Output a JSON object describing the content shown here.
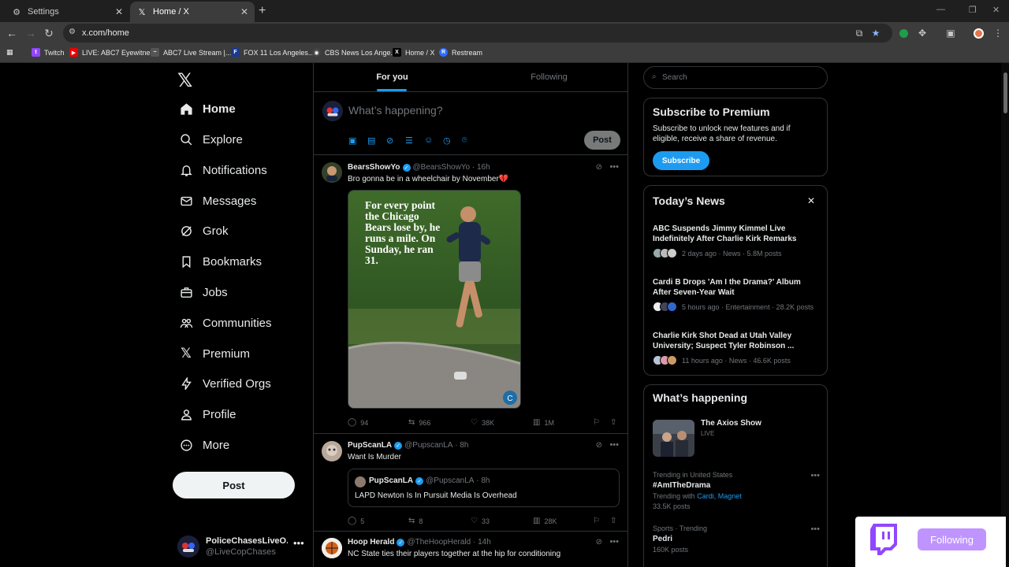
{
  "browser": {
    "tabs": [
      {
        "title": "Settings",
        "icon": "gear-icon"
      },
      {
        "title": "Home / X",
        "icon": "x-logo-icon"
      }
    ],
    "url": "x.com/home",
    "bookmarks": [
      {
        "label": "Twitch",
        "color": "#9146ff"
      },
      {
        "label": "LIVE: ABC7 Eyewitne...",
        "color": "#e00"
      },
      {
        "label": "ABC7 Live Stream |...",
        "color": "#555"
      },
      {
        "label": "FOX 11 Los Angeles...",
        "color": "#1b3a8c"
      },
      {
        "label": "CBS News Los Ange...",
        "color": "#444"
      },
      {
        "label": "Home / X",
        "color": "#000"
      },
      {
        "label": "Restream",
        "color": "#2f6bff"
      }
    ]
  },
  "sidebar": {
    "nav": [
      {
        "label": "Home",
        "icon": "home-icon"
      },
      {
        "label": "Explore",
        "icon": "search-icon"
      },
      {
        "label": "Notifications",
        "icon": "bell-icon"
      },
      {
        "label": "Messages",
        "icon": "mail-icon"
      },
      {
        "label": "Grok",
        "icon": "grok-icon"
      },
      {
        "label": "Bookmarks",
        "icon": "bookmark-icon"
      },
      {
        "label": "Jobs",
        "icon": "briefcase-icon"
      },
      {
        "label": "Communities",
        "icon": "people-icon"
      },
      {
        "label": "Premium",
        "icon": "x-logo-icon"
      },
      {
        "label": "Verified Orgs",
        "icon": "lightning-icon"
      },
      {
        "label": "Profile",
        "icon": "person-icon"
      },
      {
        "label": "More",
        "icon": "more-circle-icon"
      }
    ],
    "post_label": "Post",
    "account": {
      "name": "PoliceChasesLiveO...",
      "handle": "@LiveCopChases"
    }
  },
  "timeline": {
    "tabs": [
      "For you",
      "Following"
    ],
    "compose": {
      "placeholder": "What’s happening?",
      "post_label": "Post"
    },
    "tweets": [
      {
        "name": "BearsShowYo",
        "handle": "@BearsShowYo",
        "time": "16h",
        "text": "Bro gonna be in a wheelchair by November💔",
        "image_caption": "For every point the Chicago Bears lose by, he runs a mile. On Sunday, he ran 31.",
        "replies": "94",
        "reposts": "966",
        "likes": "38K",
        "views": "1M"
      },
      {
        "name": "PupScanLA",
        "handle": "@PupscanLA",
        "time": "8h",
        "text": "Want Is Murder",
        "quote": {
          "name": "PupScanLA",
          "handle": "@PupscanLA",
          "time": "8h",
          "text": "LAPD Newton Is In Pursuit Media Is Overhead"
        },
        "replies": "5",
        "reposts": "8",
        "likes": "33",
        "views": "28K"
      },
      {
        "name": "Hoop Herald",
        "handle": "@TheHoopHerald",
        "time": "14h",
        "text": "NC State ties their players together at the hip for conditioning"
      }
    ]
  },
  "right": {
    "search_placeholder": "Search",
    "premium": {
      "title": "Subscribe to Premium",
      "desc": "Subscribe to unlock new features and if eligible, receive a share of revenue.",
      "button": "Subscribe"
    },
    "news": {
      "title": "Today’s News",
      "items": [
        {
          "headline": "ABC Suspends Jimmy Kimmel Live Indefinitely After Charlie Kirk Remarks",
          "meta": "2 days ago · News · 5.8M posts"
        },
        {
          "headline": "Cardi B Drops 'Am I the Drama?' Album After Seven-Year Wait",
          "meta": "5 hours ago · Entertainment · 28.2K posts"
        },
        {
          "headline": "Charlie Kirk Shot Dead at Utah Valley University; Suspect Tyler Robinson ...",
          "meta": "11 hours ago · News · 46.6K posts"
        }
      ]
    },
    "happening": {
      "title": "What’s happening",
      "live": {
        "title": "The Axios Show",
        "status": "LIVE"
      },
      "trends": [
        {
          "context": "Trending in United States",
          "topic": "#AmITheDrama",
          "with_label": "Trending with",
          "with_links": "Cardi, Magnet",
          "count": "33.5K posts"
        },
        {
          "context": "Sports · Trending",
          "topic": "Pedri",
          "count": "160K posts"
        }
      ]
    }
  },
  "twitch_widget": {
    "button": "Following"
  }
}
